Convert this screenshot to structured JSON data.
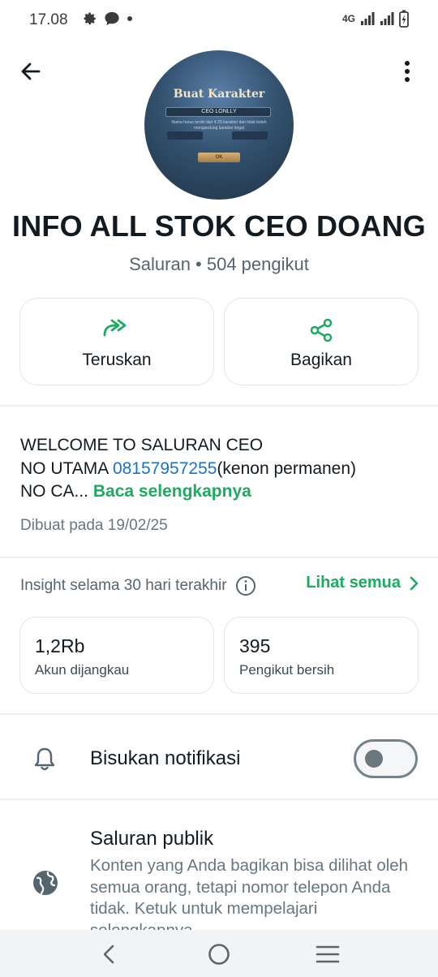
{
  "status_bar": {
    "time": "17.08",
    "network": "4G"
  },
  "avatar": {
    "title": "Buat Karakter",
    "field_text": "CEO LONLLY",
    "note": "Nama harus terdiri dari 4-25 karakter dan tidak boleh mengandung karakter ilegal",
    "button": "OK",
    "corner": "Ganti Ma"
  },
  "header": {
    "channel_name": "INFO ALL STOK CEO DOANG",
    "subtitle": "Saluran • 504 pengikut"
  },
  "actions": {
    "forward_label": "Teruskan",
    "share_label": "Bagikan"
  },
  "description": {
    "line1": "WELCOME TO SALURAN CEO",
    "line2_prefix": "NO UTAMA ",
    "phone": "08157957255",
    "line2_suffix": "(kenon permanen)",
    "line3_prefix": "NO CA... ",
    "read_more": "Baca selengkapnya",
    "created": "Dibuat pada 19/02/25"
  },
  "insight": {
    "title": "Insight selama 30 hari terakhir",
    "see_all": "Lihat semua",
    "reached_value": "1,2Rb",
    "reached_label": "Akun dijangkau",
    "followers_value": "395",
    "followers_label": "Pengikut bersih"
  },
  "mute": {
    "label": "Bisukan notifikasi",
    "enabled": false
  },
  "public": {
    "title": "Saluran publik",
    "description": "Konten yang Anda bagikan bisa dilihat oleh semua orang, tetapi nomor telepon Anda tidak. Ketuk untuk mempelajari selengkapnya"
  },
  "colors": {
    "accent": "#1daa61",
    "link": "#1a72c9",
    "text": "#111b21",
    "muted": "#667781"
  }
}
